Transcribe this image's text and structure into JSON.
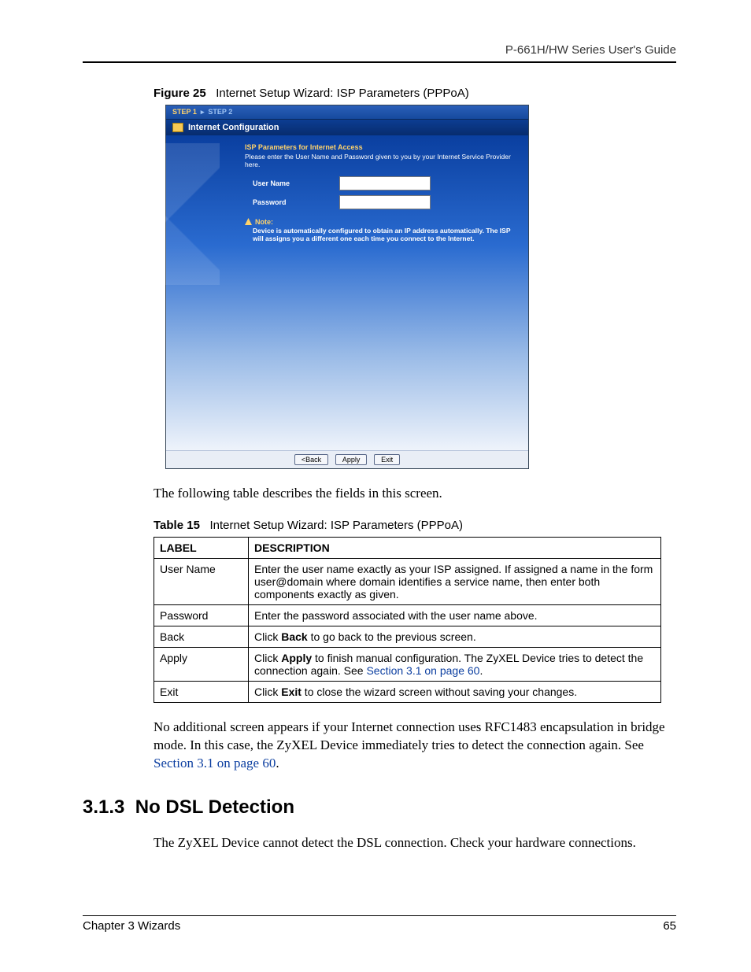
{
  "runningHead": "P-661H/HW Series User's Guide",
  "figure": {
    "label": "Figure 25",
    "title": "Internet Setup Wizard: ISP Parameters (PPPoA)"
  },
  "wizard": {
    "steps": {
      "active": "STEP 1",
      "inactive": "STEP 2"
    },
    "heading": "Internet Configuration",
    "ispTitle": "ISP Parameters for Internet Access",
    "ispSub": "Please enter the User Name and Password given to you by your Internet Service Provider here.",
    "labels": {
      "username": "User Name",
      "password": "Password"
    },
    "noteLabel": "Note:",
    "noteText": "Device is automatically configured to obtain an IP address automatically. The ISP will assigns you a different one each time you connect to the Internet.",
    "buttons": {
      "back": "<Back",
      "apply": "Apply",
      "exit": "Exit"
    }
  },
  "introText": "The following table describes the fields in this screen.",
  "table": {
    "label": "Table 15",
    "title": "Internet Setup Wizard: ISP Parameters (PPPoA)",
    "headers": {
      "c1": "LABEL",
      "c2": "DESCRIPTION"
    },
    "rows": [
      {
        "label": "User Name",
        "desc": "Enter the user name exactly as your ISP assigned. If assigned a name in the form user@domain where domain identifies a service name, then enter both components exactly as given."
      },
      {
        "label": "Password",
        "desc": "Enter the password associated with the user name above."
      },
      {
        "label": "Back",
        "desc_pre": "Click ",
        "desc_b": "Back",
        "desc_post": " to go back to the previous screen."
      },
      {
        "label": "Apply",
        "desc_pre": "Click ",
        "desc_b": "Apply",
        "desc_post": " to finish manual configuration. The ZyXEL Device tries to detect the connection again. See ",
        "xref": "Section 3.1 on page 60",
        "tail": "."
      },
      {
        "label": "Exit",
        "desc_pre": "Click ",
        "desc_b": "Exit",
        "desc_post": " to close the wizard screen without saving your changes."
      }
    ]
  },
  "para2_pre": "No additional screen appears if your Internet connection uses RFC1483 encapsulation in bridge mode. In this case, the ZyXEL Device immediately tries to detect the connection again. See ",
  "para2_xref": "Section 3.1 on page 60",
  "para2_post": ".",
  "section": {
    "num": "3.1.3",
    "title": "No DSL Detection"
  },
  "para3": "The ZyXEL Device cannot detect the DSL connection. Check your hardware connections.",
  "footer": {
    "left": "Chapter 3 Wizards",
    "right": "65"
  }
}
